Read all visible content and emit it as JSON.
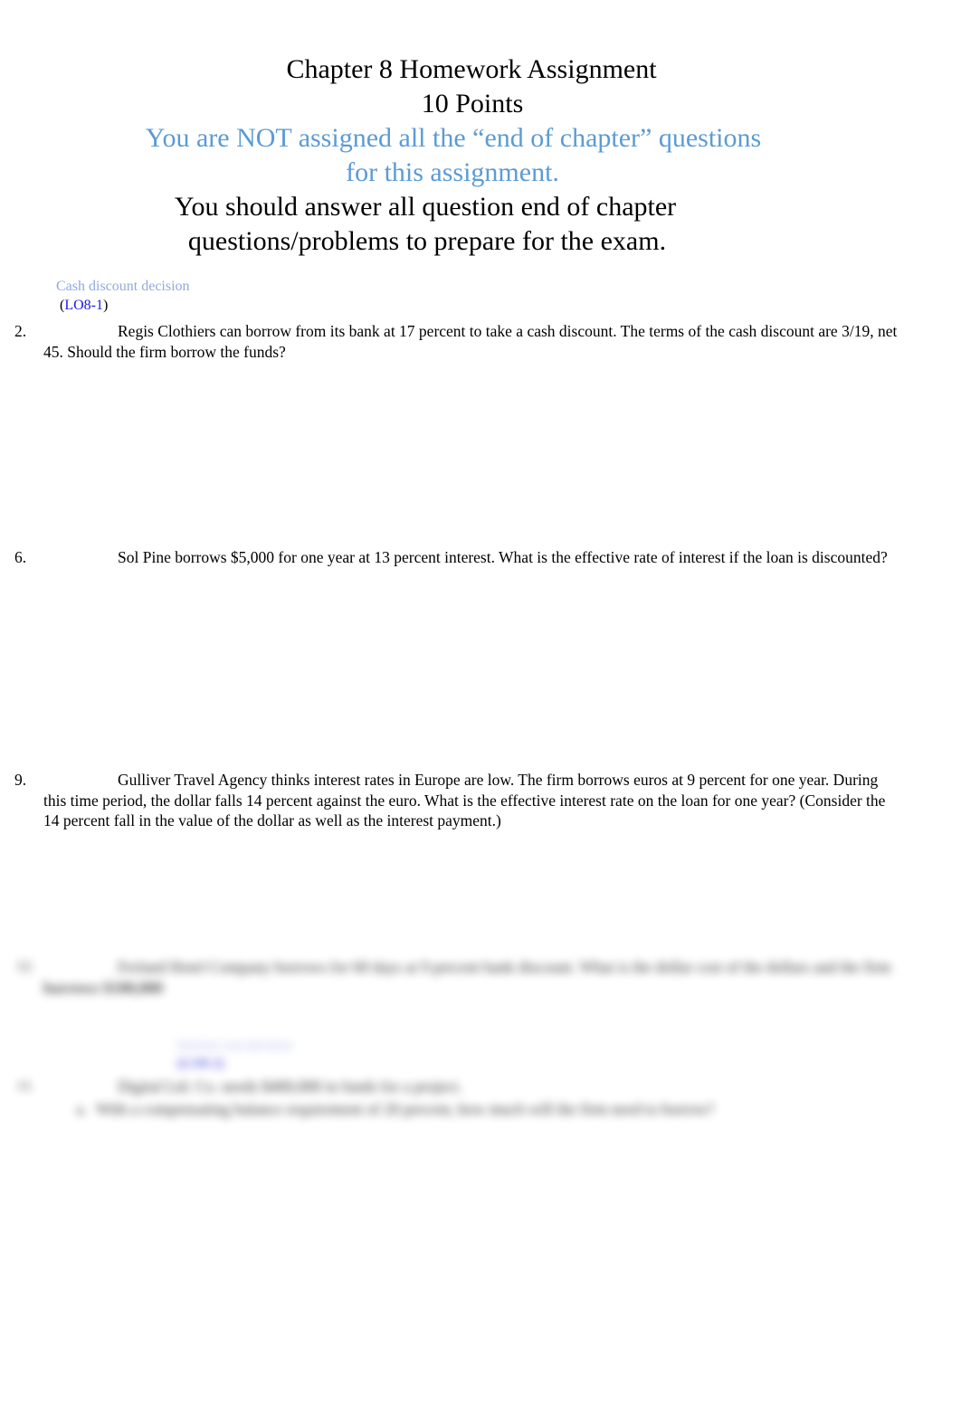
{
  "document": {
    "title_lines": [
      {
        "text": "Chapter 8 Homework Assignment",
        "color": "black"
      },
      {
        "text": "10 Points",
        "color": "black"
      },
      {
        "text": "You are NOT assigned all the “end of chapter” questions",
        "color": "#5B9BD5"
      },
      {
        "text": "for this assignment.",
        "color": "#5B9BD5"
      },
      {
        "text": "You should answer all question end of chapter",
        "color": "black"
      },
      {
        "text": "questions/problems to prepare for the exam.",
        "color": "black"
      }
    ],
    "topic": {
      "label": "Cash discount decision",
      "lo_open_paren": "(",
      "lo_link": "LO8-1",
      "lo_close_paren": ")"
    },
    "questions": [
      {
        "number": "2.",
        "text": "Regis Clothiers can borrow from its bank at 17 percent to take a cash discount. The terms of the cash discount are 3/19, net 45. Should the firm borrow the funds?"
      },
      {
        "number": "6.",
        "text": "Sol Pine borrows $5,000 for one year at 13 percent interest. What is the effective rate of interest if the loan is discounted?"
      },
      {
        "number": "9.",
        "text": "Gulliver Travel Agency thinks interest rates in Europe are low. The firm borrows euros at 9 percent for one year. During this time period, the dollar falls 14 percent against the euro. What is the effective interest rate on the loan for one year? (Consider the 14 percent fall in the value of the dollar as well as the interest payment.)"
      }
    ],
    "obscured_section": {
      "note": "bottom of page is blurred and illegible in the source image",
      "question_a": {
        "number": "12.",
        "text_part_1": "Ferland Hotel Company borrows for 60 days at 9 percent bank discount. What is the dollar cost of the",
        "text_part_2": "dollars and the firm ",
        "text_bold": "borrows $100,000"
      },
      "topic_label": "Interest cost decision",
      "topic_lo": "(LO8-2)",
      "question_b": {
        "number": "13.",
        "text": "Digital Ltd. Co. needs $400,000 in funds for a project.",
        "sub_marker": "a.",
        "sub_text": "With a compensating balance requirement of 20 percent, how much will the firm need to borrow?"
      }
    }
  }
}
